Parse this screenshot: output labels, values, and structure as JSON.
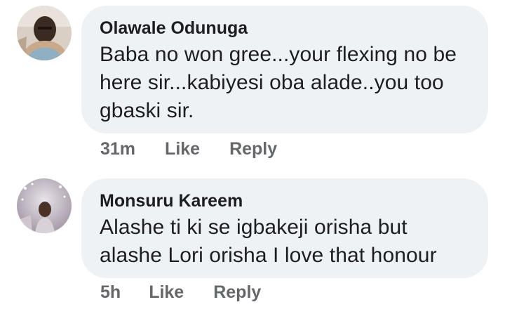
{
  "comments": [
    {
      "author": "Olawale Odunuga",
      "lines": [
        "Baba no won gree...your flexing no be",
        "here sir...kabiyesi oba alade..you too",
        "gbaski sir."
      ],
      "time": "31m",
      "like_label": "Like",
      "reply_label": "Reply"
    },
    {
      "author": "Monsuru Kareem",
      "lines": [
        "Alashe ti ki se igbakeji orisha but",
        "alashe Lori orisha I love that honour"
      ],
      "time": "5h",
      "like_label": "Like",
      "reply_label": "Reply"
    }
  ],
  "colors": {
    "bubble_bg": "#eff2f5",
    "text": "#1c1e21",
    "meta": "#65676b"
  }
}
